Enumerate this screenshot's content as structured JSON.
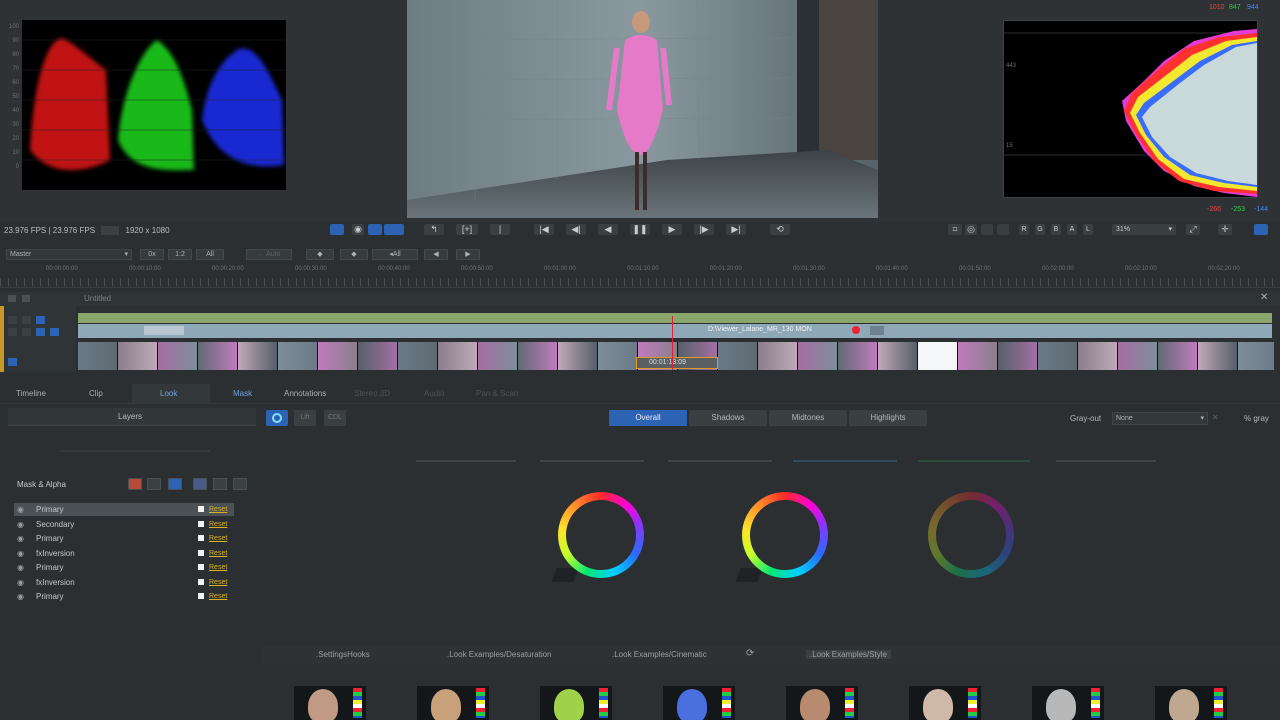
{
  "viewer": {
    "fps": "23.976 FPS | 23.976 FPS",
    "resolution": "1920 x 1080",
    "zoom": "31%",
    "hist_labels": [
      "1010",
      "847",
      "944"
    ],
    "hist_labels_bottom": [
      "-266",
      "-253",
      "-144"
    ],
    "hist_scale": [
      "443",
      "15"
    ]
  },
  "waveform_scale": [
    "100",
    "90",
    "80",
    "70",
    "60",
    "50",
    "40",
    "30",
    "20",
    "10",
    "0"
  ],
  "toolbar": {
    "master": "Master",
    "buttons": [
      "0x",
      "1:2",
      "All"
    ],
    "auto": "← Auto"
  },
  "ruler": {
    "labels": [
      "00:00:00:00",
      "00:00:10:00",
      "00:00:20:00",
      "00:00:30:00",
      "00:00:40:00",
      "00:00:50:00",
      "00:01:00:00",
      "00:01:10:00",
      "00:01:20:00",
      "00:01:30:00",
      "00:01:40:00",
      "00:01:50:00",
      "00:02:00:00",
      "00:02:10:00",
      "00:02:20:00"
    ]
  },
  "timeline": {
    "title": "Untitled",
    "clip_name": "D:\\Viewer_Lalane_MR_130 MON",
    "timecode": "00:01:13:09"
  },
  "lower_tabs": {
    "items": [
      "Timeline",
      "Clip",
      "Look",
      "Mask",
      "Annotations",
      "Stereo 3D",
      "Audio",
      "Pan & Scan"
    ]
  },
  "layers": {
    "header": "Layers",
    "mask_alpha": "Mask & Alpha",
    "rows": [
      {
        "name": "Primary",
        "reset": "Reset"
      },
      {
        "name": "Secondary",
        "reset": "Reset"
      },
      {
        "name": "Primary",
        "reset": "Reset"
      },
      {
        "name": "fxInversion",
        "reset": "Reset"
      },
      {
        "name": "Primary",
        "reset": "Reset"
      },
      {
        "name": "fxInversion",
        "reset": "Reset"
      },
      {
        "name": "Primary",
        "reset": "Reset"
      }
    ]
  },
  "color": {
    "segments": [
      "Overall",
      "Shadows",
      "Midtones",
      "Highlights"
    ],
    "small_tabs": [
      "Lift",
      "CDL"
    ],
    "grayout_label": "Gray-out",
    "grayout_value": "None",
    "pct_label": "% gray"
  },
  "presets": {
    "items": [
      ".SettingsHooks",
      ".Look Examples/Desaturation",
      ".Look Examples/Cinematic",
      ".Look Examples/Style"
    ]
  },
  "colors": {
    "accent": "#2d63b4",
    "reset": "#d6b425",
    "seq_track": "#8aa66d",
    "clip_track": "#8fa8b8"
  }
}
